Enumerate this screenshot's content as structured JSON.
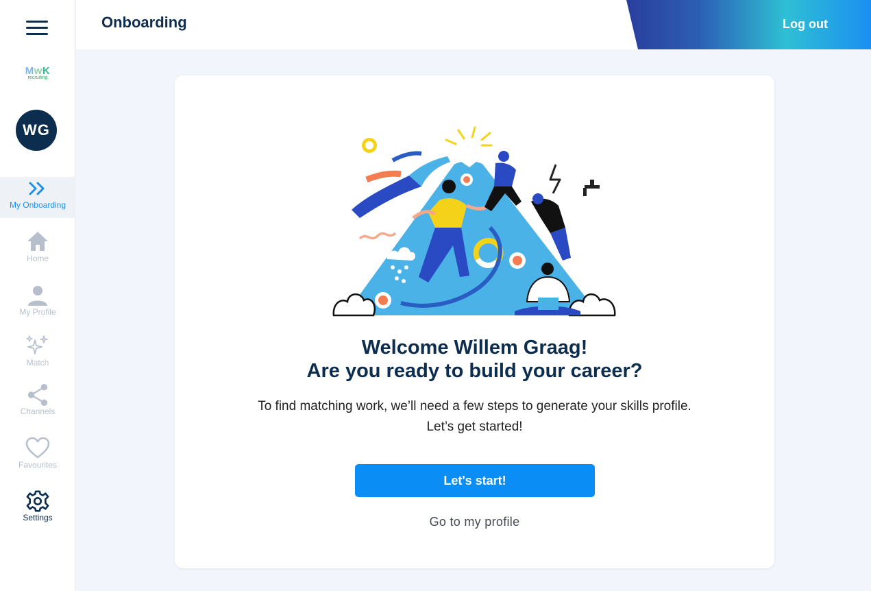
{
  "app": {
    "logo_text": "MwK",
    "logo_sub": "recruiting",
    "user_initials": "WG"
  },
  "header": {
    "title": "Onboarding",
    "logout_label": "Log out"
  },
  "sidebar": {
    "items": [
      {
        "label": "My Onboarding",
        "icon": "double-chevron-right-icon",
        "active": true
      },
      {
        "label": "Home",
        "icon": "home-icon"
      },
      {
        "label": "My Profile",
        "icon": "person-icon"
      },
      {
        "label": "Match",
        "icon": "sparkles-icon"
      },
      {
        "label": "Channels",
        "icon": "share-icon"
      },
      {
        "label": "Favourites",
        "icon": "heart-icon"
      },
      {
        "label": "Settings",
        "icon": "gear-icon"
      }
    ]
  },
  "main": {
    "welcome_line1": "Welcome Willem Graag!",
    "welcome_line2": "Are you ready to build your career?",
    "description_line1": "To find matching work, we’ll need a few steps to generate your skills profile.",
    "description_line2": "Let’s get started!",
    "start_button": "Let's start!",
    "profile_link": "Go to my profile"
  },
  "colors": {
    "navy": "#0d2d4f",
    "primary": "#0a8ef5",
    "active_nav": "#1e8fe8",
    "inactive_nav": "#b6bfcb",
    "background": "#f2f6fc"
  }
}
